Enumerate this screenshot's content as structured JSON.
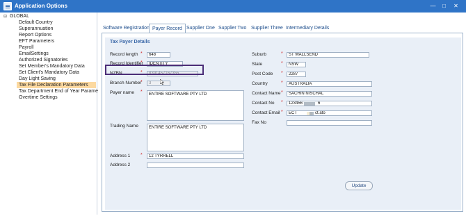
{
  "window": {
    "title": "Application Options",
    "controls": [
      "—",
      "□",
      "✕"
    ]
  },
  "sidebar": {
    "root": "GLOBAL",
    "items": [
      "Default Country",
      "Superannuation",
      "Report Options",
      "EFT Parameters",
      "Payroll",
      "EmailSettings",
      "Authorized Signatories",
      "Set Member's Mandatory Data",
      "Set Client's Mandatory Data",
      "Day Light Saving",
      "Tax File Declaration Parameters",
      "Tax Department End of Year Parameters",
      "Overtime Settings"
    ],
    "selected_index": 10
  },
  "tabs": [
    "Software Registration",
    "Payer Record",
    "Supplier One",
    "Supplier Two",
    "Supplier Three",
    "Intermediary Details"
  ],
  "active_tab": 1,
  "section_title": "Tax Payer Details",
  "left_fields": {
    "record_length": {
      "label": "Record length",
      "value": "648"
    },
    "record_identifier": {
      "label": "Record Identifier",
      "value": "IDENTITY"
    },
    "nzbn": {
      "label": "NZBN",
      "value": "8391457167355"
    },
    "branch_number": {
      "label": "Branch Number",
      "value": "3"
    },
    "payer_name": {
      "label": "Payer name",
      "value": "ENTIRE SOFTWARE PTY LTD"
    },
    "trading_name": {
      "label": "Trading Name",
      "value": "ENTIRE SOFTWARE PTY LTD"
    },
    "address1": {
      "label": "Address 1",
      "value": "12 TYRRELL"
    },
    "address2": {
      "label": "Address 2",
      "value": ""
    }
  },
  "right_fields": {
    "suburb": {
      "label": "Suburb",
      "value": "ST WALLSEND"
    },
    "state": {
      "label": "State",
      "value": "NSW"
    },
    "post_code": {
      "label": "Post Code",
      "value": "2287"
    },
    "country": {
      "label": "Country",
      "value": "AUSTRALIA"
    },
    "contact_name": {
      "label": "Contact Name",
      "value": "SACHIN NISCHAL"
    },
    "contact_no": {
      "label": "Contact No",
      "value_start": "123456",
      "value_end": "6"
    },
    "contact_email": {
      "label": "Contact Email",
      "value_start": "ECT",
      "value_end": "ct.ato"
    },
    "fax_no": {
      "label": "Fax No",
      "value": ""
    }
  },
  "required_marker": "*",
  "update_button": "Update"
}
